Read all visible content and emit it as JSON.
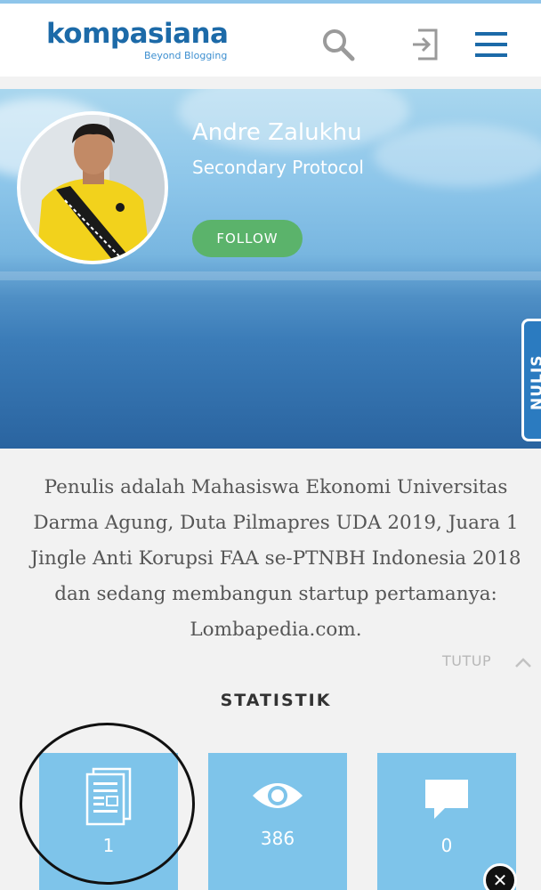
{
  "header": {
    "logo_text": "kompasiana",
    "logo_tagline": "Beyond Blogging",
    "icons": [
      "search-icon",
      "login-icon",
      "hamburger-menu-icon"
    ]
  },
  "profile": {
    "name": "Andre Zalukhu",
    "subtitle": "Secondary Protocol",
    "follow_label": "FOLLOW",
    "side_tab_label": "NULIS",
    "bio": "Penulis adalah Mahasiswa Ekonomi Universitas Darma Agung, Duta Pilmapres UDA 2019, Juara 1 Jingle Anti Korupsi FAA se-PTNBH Indonesia 2018 dan sedang membangun startup pertamanya: Lombapedia.com.",
    "collapse_label": "TUTUP"
  },
  "stats": {
    "title": "STATISTIK",
    "cards": [
      {
        "icon": "document-icon",
        "value": "1"
      },
      {
        "icon": "eye-icon",
        "value": "386"
      },
      {
        "icon": "comment-icon",
        "value": "0"
      }
    ]
  },
  "colors": {
    "brand_blue": "#1c6aa8",
    "follow_green": "#5bb36b",
    "stat_card": "#7ec4ea",
    "side_tab": "#2b7bc0"
  }
}
